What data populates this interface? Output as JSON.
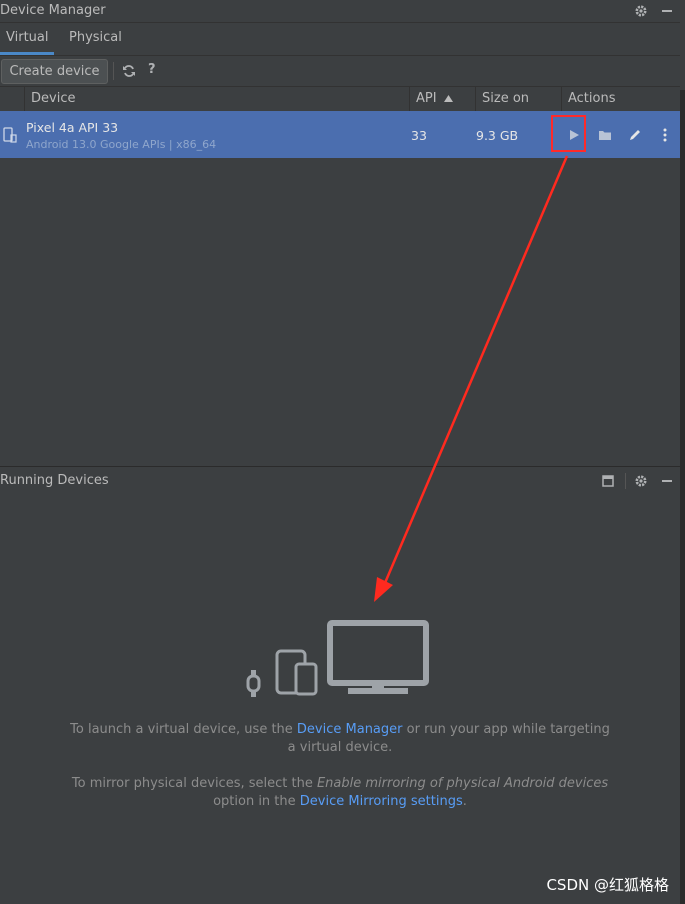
{
  "window": {
    "title": "Device Manager"
  },
  "tabs": [
    {
      "label": "Virtual"
    },
    {
      "label": "Physical"
    }
  ],
  "toolbar": {
    "create_label": "Create device",
    "help_label": "?"
  },
  "table": {
    "columns": [
      "Device",
      "API",
      "Size on Disk",
      "Actions"
    ],
    "rows": [
      {
        "name": "Pixel 4a API 33",
        "subtitle": "Android 13.0 Google APIs | x86_64",
        "api": "33",
        "size": "9.3 GB"
      }
    ]
  },
  "running": {
    "title": "Running Devices",
    "line1_a": "To launch a virtual device, use the ",
    "line1_link": "Device Manager",
    "line1_b": " or run your app while targeting",
    "line2": "a virtual device.",
    "line3_a": "To mirror physical devices, select the ",
    "line3_em": "Enable mirroring of physical Android devices",
    "line4_a": "option in the ",
    "line4_link": "Device Mirroring settings",
    "line4_b": "."
  },
  "watermark": "CSDN @红狐格格",
  "colors": {
    "selection": "#4b6eaf",
    "highlight_box": "#ff2a2a",
    "arrow": "#ff2a1f",
    "link": "#589df6"
  }
}
